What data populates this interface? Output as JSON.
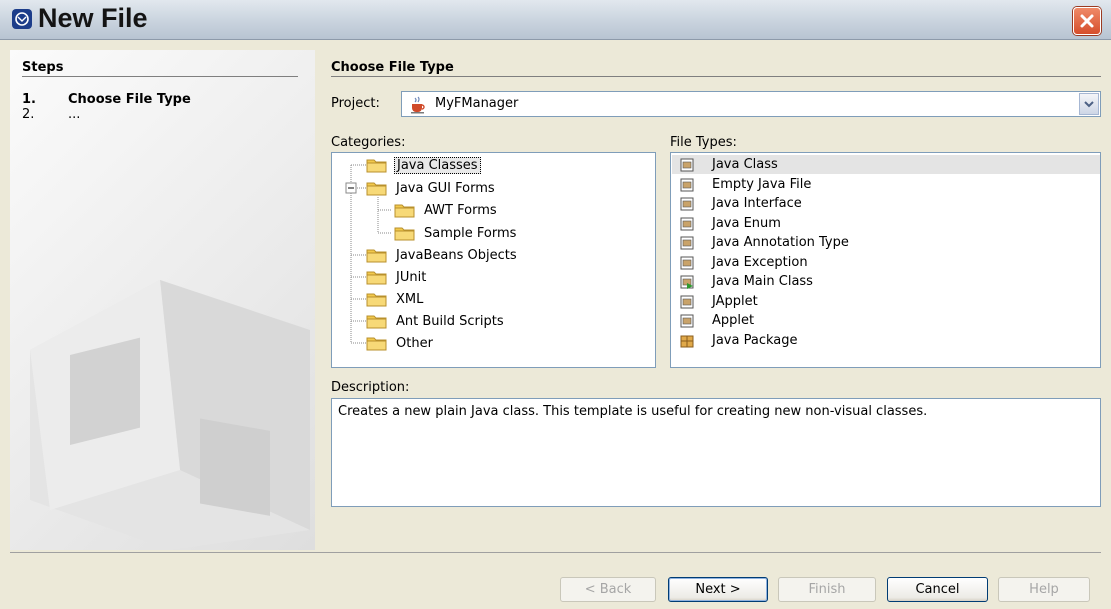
{
  "window": {
    "title": "New File"
  },
  "steps": {
    "heading": "Steps",
    "items": [
      {
        "num": "1.",
        "label": "Choose File Type"
      },
      {
        "num": "2.",
        "label": "..."
      }
    ]
  },
  "main": {
    "heading": "Choose File Type"
  },
  "project": {
    "label": "Project:",
    "value": "MyFManager"
  },
  "categories": {
    "label": "Categories:",
    "items": [
      "Java Classes",
      "Java GUI Forms",
      "AWT Forms",
      "Sample Forms",
      "JavaBeans Objects",
      "JUnit",
      "XML",
      "Ant Build Scripts",
      "Other"
    ],
    "selected": "Java Classes"
  },
  "file_types": {
    "label": "File Types:",
    "items": [
      "Java Class",
      "Empty Java File",
      "Java Interface",
      "Java Enum",
      "Java Annotation Type",
      "Java Exception",
      "Java Main Class",
      "JApplet",
      "Applet",
      "Java Package"
    ],
    "selected": "Java Class"
  },
  "description": {
    "label": "Description:",
    "text": "Creates a new plain Java class. This template is useful for creating new non-visual classes."
  },
  "buttons": {
    "back": "< Back",
    "next": "Next >",
    "finish": "Finish",
    "cancel": "Cancel",
    "help": "Help"
  },
  "colors": {
    "folder": "#f2c94c",
    "close": "#d64e2c",
    "selection": "#e4e4e4"
  }
}
